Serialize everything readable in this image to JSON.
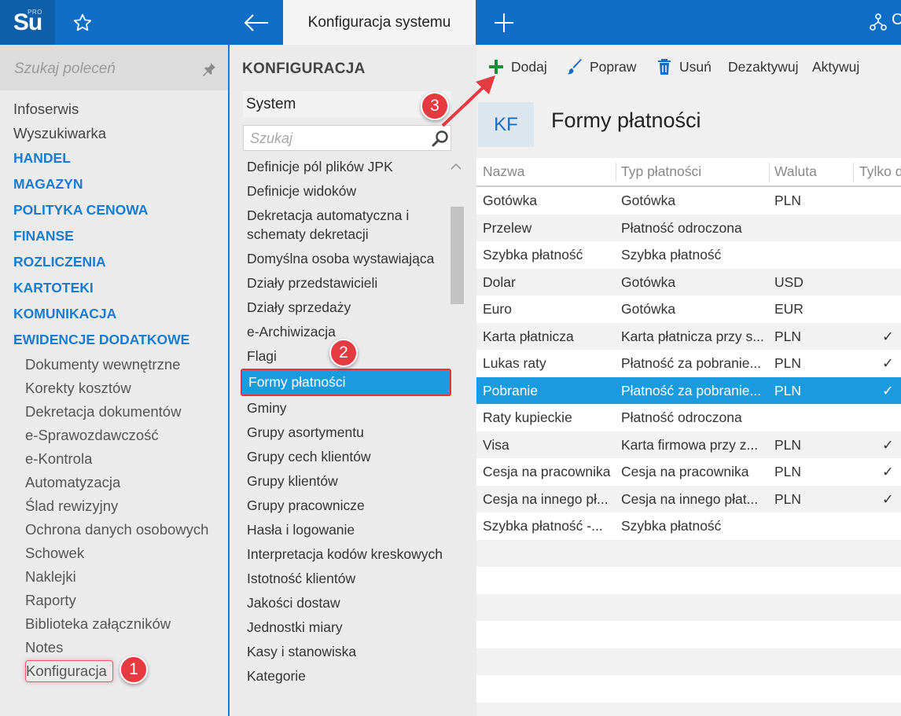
{
  "topbar": {
    "logo_text": "Su",
    "logo_badge": "PRO",
    "active_tab_title": "Konfiguracja systemu",
    "right_cut_text": "C"
  },
  "left_nav": {
    "search_placeholder": "Szukaj poleceń",
    "items": [
      "Infoserwis",
      "Wyszukiwarka"
    ],
    "sections": [
      "HANDEL",
      "MAGAZYN",
      "POLITYKA CENOWA",
      "FINANSE",
      "ROZLICZENIA",
      "KARTOTEKI",
      "KOMUNIKACJA",
      "EWIDENCJE DODATKOWE"
    ],
    "sub_items": [
      "Dokumenty wewnętrzne",
      "Korekty kosztów",
      "Dekretacja dokumentów",
      "e-Sprawozdawczość",
      "e-Kontrola",
      "Automatyzacja",
      "Ślad rewizyjny",
      "Ochrona danych osobowych",
      "Schowek",
      "Naklejki",
      "Raporty",
      "Biblioteka załączników",
      "Notes",
      "Konfiguracja"
    ]
  },
  "config": {
    "title": "KONFIGURACJA",
    "selector_value": "System",
    "search_placeholder": "Szukaj",
    "items": [
      "Definicje pól plików JPK",
      "Definicje widoków",
      "Dekretacja automatyczna i schematy dekretacji",
      "Domyślna osoba wystawiająca",
      "Działy przedstawicieli",
      "Działy sprzedaży",
      "e-Archiwizacja",
      "Flagi",
      "Formy płatności",
      "Gminy",
      "Grupy asortymentu",
      "Grupy cech klientów",
      "Grupy klientów",
      "Grupy pracownicze",
      "Hasła i logowanie",
      "Interpretacja kodów kreskowych",
      "Istotność klientów",
      "Jakości dostaw",
      "Jednostki miary",
      "Kasy i stanowiska",
      "Kategorie"
    ]
  },
  "toolbar": {
    "add": "Dodaj",
    "edit": "Popraw",
    "delete": "Usuń",
    "deactivate": "Dezaktywuj",
    "activate": "Aktywuj"
  },
  "page": {
    "tile": "KF",
    "title": "Formy płatności"
  },
  "grid": {
    "columns": [
      "Nazwa",
      "Typ płatności",
      "Waluta",
      "Tylko d"
    ],
    "rows": [
      [
        "Gotówka",
        "Gotówka",
        "PLN",
        ""
      ],
      [
        "Przelew",
        "Płatność odroczona",
        "",
        ""
      ],
      [
        "Szybka płatność",
        "Szybka płatność",
        "",
        ""
      ],
      [
        "Dolar",
        "Gotówka",
        "USD",
        ""
      ],
      [
        "Euro",
        "Gotówka",
        "EUR",
        ""
      ],
      [
        "Karta płatnicza",
        "Karta płatnicza przy s...",
        "PLN",
        "✓"
      ],
      [
        "Lukas raty",
        "Płatność za pobranie...",
        "PLN",
        "✓"
      ],
      [
        "Pobranie",
        "Płatność za pobranie...",
        "PLN",
        "✓"
      ],
      [
        "Raty kupieckie",
        "Płatność odroczona",
        "",
        ""
      ],
      [
        "Visa",
        "Karta firmowa przy z...",
        "PLN",
        "✓"
      ],
      [
        "Cesja na pracownika",
        "Cesja na pracownika",
        "PLN",
        "✓"
      ],
      [
        "Cesja na innego pł...",
        "Cesja na innego płat...",
        "PLN",
        "✓"
      ],
      [
        "Szybka płatność -...",
        "Szybka płatność",
        "",
        ""
      ]
    ]
  },
  "annotations": [
    "1",
    "2",
    "3"
  ],
  "colors": {
    "brand_blue": "#0f6fc6",
    "section_blue": "#1a7bcf",
    "selection_blue": "#1a9be0",
    "annotation_red": "#e53a3f",
    "add_green": "#1f8a3b"
  }
}
